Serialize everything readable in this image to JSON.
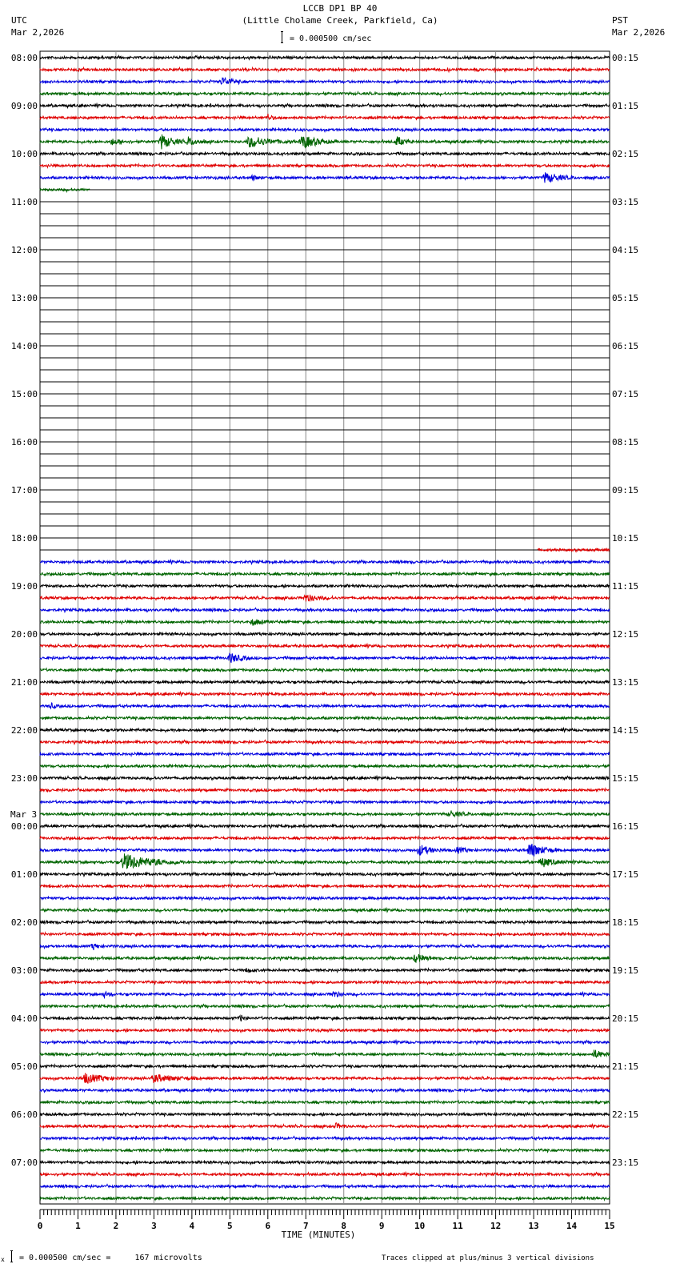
{
  "header": {
    "title": "LCCB DP1 BP 40",
    "subtitle": "(Little Cholame Creek, Parkfield, Ca)",
    "left_tz": "UTC",
    "left_date": "Mar 2,2026",
    "right_tz": "PST",
    "right_date": "Mar 2,2026",
    "scale_text": "= 0.000500 cm/sec"
  },
  "footer": {
    "scale_text": "= 0.000500 cm/sec =     167 microvolts",
    "clip_note": "Traces clipped at plus/minus 3 vertical divisions"
  },
  "chart_data": {
    "type": "line",
    "title": "LCCB DP1 BP 40",
    "xlabel": "TIME (MINUTES)",
    "xlim": [
      0,
      15
    ],
    "x_ticks": [
      "0",
      "1",
      "2",
      "3",
      "4",
      "5",
      "6",
      "7",
      "8",
      "9",
      "10",
      "11",
      "12",
      "13",
      "14",
      "15"
    ],
    "trace_colors": [
      "#000000",
      "#e00000",
      "#0000e0",
      "#006400"
    ],
    "rows_per_hour": 4,
    "row_count": 96,
    "left_labels": [
      "08:00",
      "09:00",
      "10:00",
      "11:00",
      "12:00",
      "13:00",
      "14:00",
      "15:00",
      "16:00",
      "17:00",
      "18:00",
      "19:00",
      "20:00",
      "21:00",
      "22:00",
      "23:00",
      "00:00",
      "01:00",
      "02:00",
      "03:00",
      "04:00",
      "05:00",
      "06:00",
      "07:00"
    ],
    "day_change_label": "Mar 3",
    "right_labels": [
      "00:15",
      "01:15",
      "02:15",
      "03:15",
      "04:15",
      "05:15",
      "06:15",
      "07:15",
      "08:15",
      "09:15",
      "10:15",
      "11:15",
      "12:15",
      "13:15",
      "14:15",
      "15:15",
      "16:15",
      "17:15",
      "18:15",
      "19:15",
      "20:15",
      "21:15",
      "22:15",
      "23:15"
    ],
    "data_segments": [
      {
        "from_row": 0,
        "to_row": 10,
        "start_min": 0,
        "end_min": 15
      },
      {
        "from_row": 11,
        "to_row": 11,
        "start_min": 0,
        "end_min": 1.3
      },
      {
        "from_row": 41,
        "to_row": 41,
        "start_min": 13.1,
        "end_min": 15
      },
      {
        "from_row": 42,
        "to_row": 95,
        "start_min": 0,
        "end_min": 15
      }
    ],
    "events": [
      {
        "row": 2,
        "minute": 4.8,
        "amplitude": 2.5,
        "duration": 0.6
      },
      {
        "row": 5,
        "minute": 6.0,
        "amplitude": 1.5,
        "duration": 0.3
      },
      {
        "row": 7,
        "minute": 1.9,
        "amplitude": 1.8,
        "duration": 0.5
      },
      {
        "row": 7,
        "minute": 3.2,
        "amplitude": 4.5,
        "duration": 0.6
      },
      {
        "row": 7,
        "minute": 3.9,
        "amplitude": 2.2,
        "duration": 0.6
      },
      {
        "row": 7,
        "minute": 5.5,
        "amplitude": 3.2,
        "duration": 1.2
      },
      {
        "row": 7,
        "minute": 6.9,
        "amplitude": 4.0,
        "duration": 0.9
      },
      {
        "row": 7,
        "minute": 9.4,
        "amplitude": 2.8,
        "duration": 0.4
      },
      {
        "row": 10,
        "minute": 5.6,
        "amplitude": 1.5,
        "duration": 0.3
      },
      {
        "row": 10,
        "minute": 13.3,
        "amplitude": 3.0,
        "duration": 0.8
      },
      {
        "row": 45,
        "minute": 7.0,
        "amplitude": 2.2,
        "duration": 0.7
      },
      {
        "row": 47,
        "minute": 5.6,
        "amplitude": 1.8,
        "duration": 0.5
      },
      {
        "row": 50,
        "minute": 5.0,
        "amplitude": 3.0,
        "duration": 0.6
      },
      {
        "row": 54,
        "minute": 0.3,
        "amplitude": 1.5,
        "duration": 0.2
      },
      {
        "row": 63,
        "minute": 10.8,
        "amplitude": 1.5,
        "duration": 0.6
      },
      {
        "row": 66,
        "minute": 10.0,
        "amplitude": 3.2,
        "duration": 0.6
      },
      {
        "row": 66,
        "minute": 11.0,
        "amplitude": 1.8,
        "duration": 0.4
      },
      {
        "row": 66,
        "minute": 12.9,
        "amplitude": 5.0,
        "duration": 0.7
      },
      {
        "row": 67,
        "minute": 2.2,
        "amplitude": 5.0,
        "duration": 1.6
      },
      {
        "row": 67,
        "minute": 13.2,
        "amplitude": 2.5,
        "duration": 0.8
      },
      {
        "row": 74,
        "minute": 1.4,
        "amplitude": 1.5,
        "duration": 0.3
      },
      {
        "row": 75,
        "minute": 9.9,
        "amplitude": 3.0,
        "duration": 0.4
      },
      {
        "row": 76,
        "minute": 5.5,
        "amplitude": 1.2,
        "duration": 0.2
      },
      {
        "row": 78,
        "minute": 1.7,
        "amplitude": 1.5,
        "duration": 0.3
      },
      {
        "row": 78,
        "minute": 7.7,
        "amplitude": 1.8,
        "duration": 0.4
      },
      {
        "row": 80,
        "minute": 5.3,
        "amplitude": 1.5,
        "duration": 0.2
      },
      {
        "row": 83,
        "minute": 14.6,
        "amplitude": 2.5,
        "duration": 0.5
      },
      {
        "row": 85,
        "minute": 1.2,
        "amplitude": 3.2,
        "duration": 0.9
      },
      {
        "row": 85,
        "minute": 3.0,
        "amplitude": 2.2,
        "duration": 1.2
      },
      {
        "row": 89,
        "minute": 7.8,
        "amplitude": 1.5,
        "duration": 0.3
      }
    ]
  }
}
